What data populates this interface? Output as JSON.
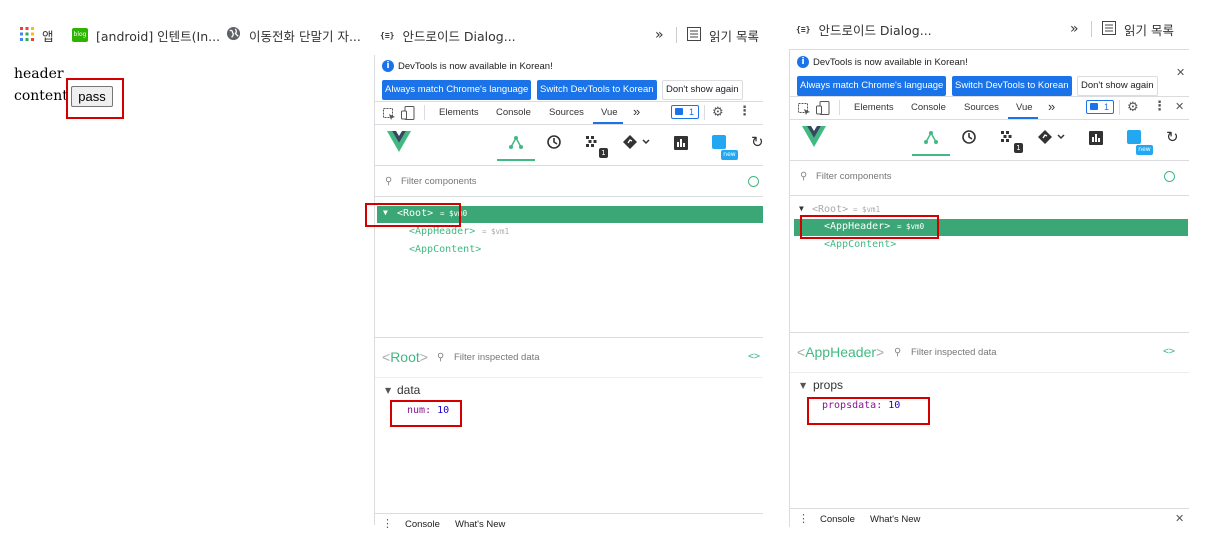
{
  "bookmarks": {
    "apps": "앱",
    "blog": "[android] 인텐트(In...",
    "mobile": "이동전화 단말기 자...",
    "dialog": "안드로이드 Dialog...",
    "more": "»",
    "reading_list": "읽기 목록",
    "dialog_right": "안드로이드 Dialog...",
    "more_right": "»",
    "reading_list_right": "읽기 목록",
    "blog_badge": "blog",
    "code_icon": "{≡}"
  },
  "page": {
    "header_text": "header",
    "content_text": "content",
    "button_label": "pass"
  },
  "devtools_left": {
    "banner_text": "DevTools is now available in Korean!",
    "btn_match": "Always match Chrome's language",
    "btn_switch": "Switch DevTools to Korean",
    "btn_dont": "Don't show again",
    "tabs": [
      "Elements",
      "Console",
      "Sources",
      "Vue",
      "»"
    ],
    "badge": "1",
    "filter_components": "Filter components",
    "root": "<Root>",
    "vm0": "= $vm0",
    "app_header": "<AppHeader>",
    "vm1": "= $vm1",
    "app_content": "<AppContent>",
    "inspected_title": "<Root>",
    "filter_inspected": "Filter inspected data",
    "section": "data",
    "prop_key": "num",
    "prop_value": "10",
    "drawer_console": "Console",
    "drawer_whats_new": "What's New",
    "new_badge": "new"
  },
  "devtools_right": {
    "banner_text": "DevTools is now available in Korean!",
    "btn_match": "Always match Chrome's language",
    "btn_switch": "Switch DevTools to Korean",
    "btn_dont": "Don't show again",
    "tabs": [
      "Elements",
      "Console",
      "Sources",
      "Vue",
      "»"
    ],
    "badge": "1",
    "filter_components": "Filter components",
    "root": "<Root>",
    "vm1": "= $vm1",
    "app_header": "<AppHeader>",
    "vm0": "= $vm0",
    "app_content": "<AppContent>",
    "inspected_title": "<AppHeader>",
    "filter_inspected": "Filter inspected data",
    "section": "props",
    "prop_key": "propsdata",
    "prop_value": "10",
    "drawer_console": "Console",
    "drawer_whats_new": "What's New",
    "new_badge": "new"
  },
  "colors": {
    "vue_green": "#42b983",
    "highlight": "#d40000",
    "blue": "#1a73e8"
  }
}
